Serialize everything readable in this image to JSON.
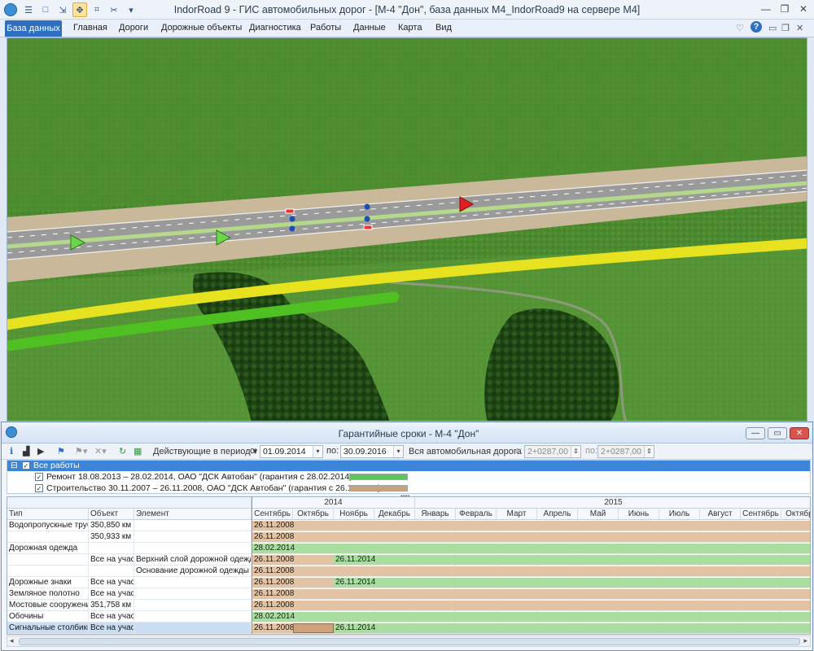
{
  "window": {
    "title": "IndorRoad 9 - ГИС автомобильных дорог - [М-4 \"Дон\", база данных M4_IndorRoad9 на сервере M4]"
  },
  "menu": [
    "База данных",
    "Главная",
    "Дороги",
    "Дорожные объекты",
    "Диагностика",
    "Работы",
    "Данные",
    "Карта",
    "Вид"
  ],
  "panel": {
    "title": "Гарантийные сроки - М-4 \"Дон\"",
    "toolbar": {
      "period_label": "Действующие в период",
      "from_label": "с:",
      "from_value": "01.09.2014",
      "to_label": "по:",
      "to_value": "30.09.2016",
      "road_scope": "Вся автомобильная дорога",
      "km_from_label": "с:",
      "km_from": "2+0287,00",
      "km_to_label": "по:",
      "km_to": "2+0287,00"
    },
    "tree": {
      "root": "Все работы",
      "items": [
        {
          "label": "Ремонт 18.08.2013 – 28.02.2014, ОАО \"ДСК Автобан\" (гарантия с 28.02.2014)",
          "color": "#5fc55a"
        },
        {
          "label": "Строительство 30.11.2007 – 26.11.2008, ОАО \"ДСК Автобан\" (гарантия с 26.11.2008)",
          "color": "#caa07d"
        }
      ]
    },
    "grid": {
      "columns": {
        "type": "Тип",
        "object": "Объект",
        "element": "Элемент"
      },
      "years": [
        "2014",
        "2015"
      ],
      "months": [
        "Сентябрь",
        "Октябрь",
        "Ноябрь",
        "Декабрь",
        "Январь",
        "Февраль",
        "Март",
        "Апрель",
        "Май",
        "Июнь",
        "Июль",
        "Август",
        "Сентябрь",
        "Октябрь"
      ],
      "rows": [
        {
          "type": "Водопропускные трубы",
          "object": "350,850 км ...",
          "element": "",
          "bars": [
            {
              "kind": "or",
              "start": 0,
              "text": "26.11.2008"
            }
          ]
        },
        {
          "type": "",
          "object": "350,933 км ...",
          "element": "",
          "bars": [
            {
              "kind": "or",
              "start": 0,
              "text": "26.11.2008"
            }
          ]
        },
        {
          "type": "Дорожная одежда",
          "object": "",
          "element": "",
          "bars": [
            {
              "kind": "gr",
              "start": 0,
              "text": "28.02.2014"
            }
          ]
        },
        {
          "type": "",
          "object": "Все на учас...",
          "element": "Верхний слой дорожной одежды",
          "bars": [
            {
              "kind": "or",
              "start": 0,
              "end": 2,
              "text": "26.11.2008"
            },
            {
              "kind": "gr",
              "start": 2,
              "text": "26.11.2014"
            }
          ]
        },
        {
          "type": "",
          "object": "",
          "element": "Основание дорожной одежды",
          "bars": [
            {
              "kind": "or",
              "start": 0,
              "text": "26.11.2008"
            }
          ]
        },
        {
          "type": "Дорожные знаки",
          "object": "Все на учас...",
          "element": "",
          "bars": [
            {
              "kind": "or",
              "start": 0,
              "end": 2,
              "text": "26.11.2008"
            },
            {
              "kind": "gr",
              "start": 2,
              "text": "26.11.2014"
            }
          ]
        },
        {
          "type": "Земляное полотно",
          "object": "Все на учас...",
          "element": "",
          "bars": [
            {
              "kind": "or",
              "start": 0,
              "text": "26.11.2008"
            }
          ]
        },
        {
          "type": "Мостовые сооружения",
          "object": "351,758 км ...",
          "element": "",
          "bars": [
            {
              "kind": "or",
              "start": 0,
              "text": "26.11.2008"
            }
          ]
        },
        {
          "type": "Обочины",
          "object": "Все на учас...",
          "element": "",
          "bars": [
            {
              "kind": "gr",
              "start": 0,
              "text": "28.02.2014"
            }
          ]
        },
        {
          "type": "Сигнальные столбики",
          "object": "Все на учас...",
          "element": "",
          "selected": true,
          "bars": [
            {
              "kind": "or",
              "start": 0,
              "end": 1,
              "text": "26.11.2008"
            },
            {
              "kind": "or2",
              "start": 1,
              "end": 2,
              "text": ""
            },
            {
              "kind": "gr",
              "start": 2,
              "text": "26.11.2014"
            }
          ]
        }
      ]
    }
  }
}
